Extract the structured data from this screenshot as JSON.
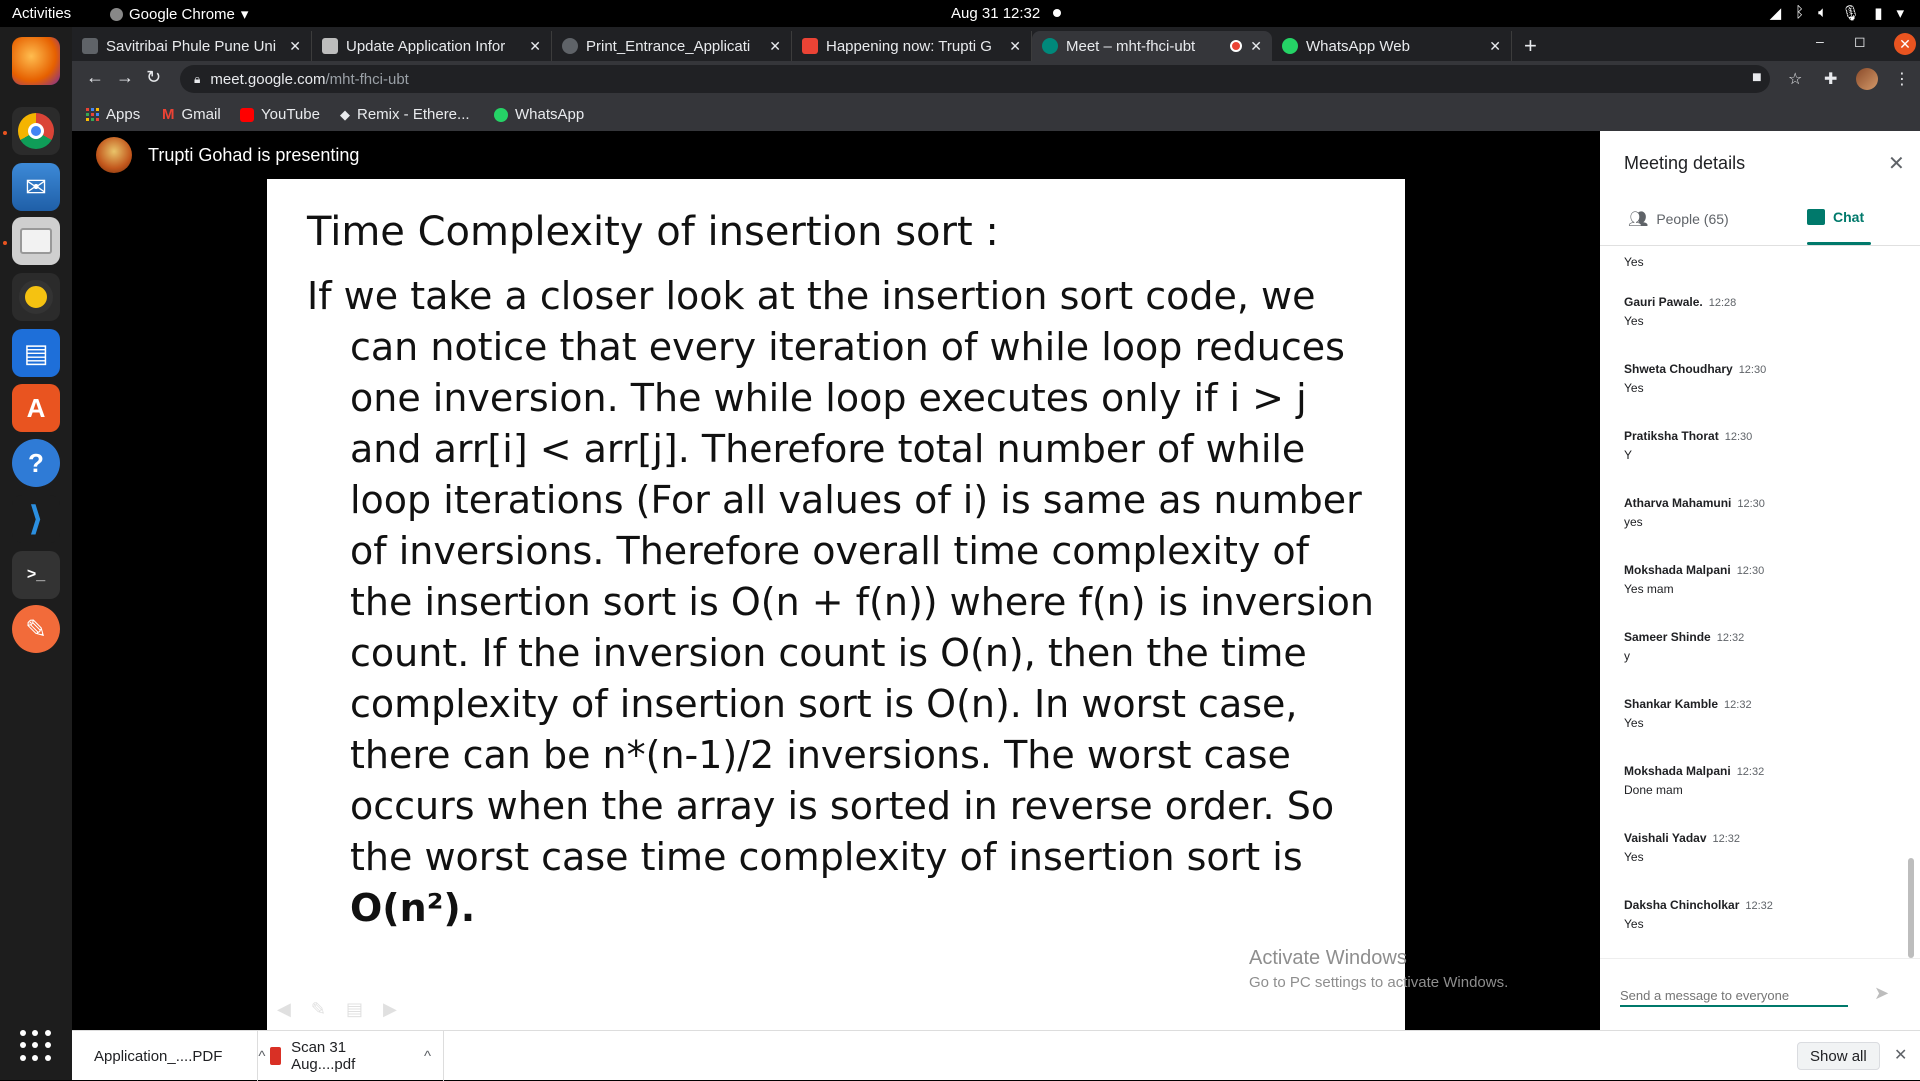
{
  "system": {
    "activities": "Activities",
    "app_name": "Google Chrome",
    "clock": "Aug 31  12:32"
  },
  "tabs": [
    {
      "label": "Savitribai Phule Pune Uni",
      "icon_color": "#5f6368",
      "active": false
    },
    {
      "label": "Update Application Infor",
      "icon_color": "#bdbdbd",
      "active": false
    },
    {
      "label": "Print_Entrance_Applicati",
      "icon_color": "#5f6368",
      "active": false
    },
    {
      "label": "Happening now: Trupti G",
      "icon_color": "#ea4335",
      "active": false
    },
    {
      "label": "Meet – mht-fhci-ubt",
      "icon_color": "#00897b",
      "active": true
    },
    {
      "label": "WhatsApp Web",
      "icon_color": "#25d366",
      "active": false
    }
  ],
  "address": {
    "domain": "meet.google.com",
    "path": "/mht-fhci-ubt"
  },
  "bookmarks": [
    {
      "label": "Apps",
      "icon_color": "#4285f4"
    },
    {
      "label": "Gmail",
      "icon_color": "#ea4335"
    },
    {
      "label": "YouTube",
      "icon_color": "#ff0000"
    },
    {
      "label": "Remix - Ethere...",
      "icon_color": "#e8eaed"
    },
    {
      "label": "WhatsApp",
      "icon_color": "#25d366"
    }
  ],
  "meet": {
    "presenter_text": "Trupti Gohad is presenting"
  },
  "slide": {
    "title": "Time Complexity of insertion sort :",
    "first_line": "If we take a closer look at the insertion sort code, we",
    "body": "can notice that every iteration of while loop reduces one inversion. The while loop executes only if i > j and arr[i] < arr[j]. Therefore total number of while loop iterations (For all values of i) is same as number of inversions. Therefore overall time complexity of the insertion sort is O(n + f(n)) where f(n) is inversion count. If the inversion count is O(n), then the time complexity of insertion sort is O(n). In worst case, there can be n*(n-1)/2 inversions. The worst case occurs when the array is sorted in reverse order. So the worst case time complexity of insertion sort is",
    "bold_end": "O(n²)."
  },
  "watermark": {
    "line1": "Activate Windows",
    "line2": "Go to PC settings to activate Windows."
  },
  "panel": {
    "title": "Meeting details",
    "people_tab": "People (65)",
    "chat_tab": "Chat",
    "first_text": "Yes",
    "messages": [
      {
        "sender": "Gauri Pawale.",
        "time": "12:28",
        "text": "Yes"
      },
      {
        "sender": "Shweta Choudhary",
        "time": "12:30",
        "text": "Yes"
      },
      {
        "sender": "Pratiksha Thorat",
        "time": "12:30",
        "text": "Y"
      },
      {
        "sender": "Atharva Mahamuni",
        "time": "12:30",
        "text": "yes"
      },
      {
        "sender": "Mokshada Malpani",
        "time": "12:30",
        "text": "Yes mam"
      },
      {
        "sender": "Sameer Shinde",
        "time": "12:32",
        "text": "y"
      },
      {
        "sender": "Shankar Kamble",
        "time": "12:32",
        "text": "Yes"
      },
      {
        "sender": "Mokshada Malpani",
        "time": "12:32",
        "text": "Done mam"
      },
      {
        "sender": "Vaishali Yadav",
        "time": "12:32",
        "text": "Yes"
      },
      {
        "sender": "Daksha Chincholkar",
        "time": "12:32",
        "text": "Yes"
      }
    ],
    "composer_placeholder": "Send a message to everyone"
  },
  "downloads": {
    "items": [
      "Application_....PDF",
      "Scan 31 Aug....pdf"
    ],
    "show_all": "Show all"
  }
}
